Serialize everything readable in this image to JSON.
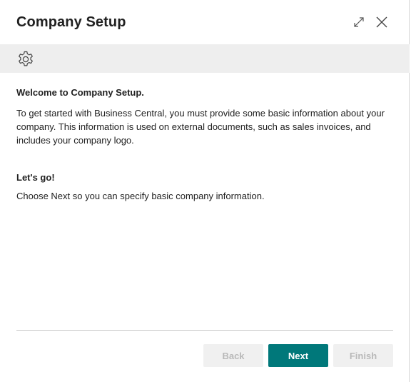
{
  "dialog": {
    "title": "Company Setup",
    "expand_icon": "expand-diagonal-icon",
    "close_icon": "close-x-icon"
  },
  "banner": {
    "icon": "gear-icon"
  },
  "intro": {
    "heading": "Welcome to Company Setup.",
    "body": "To get started with Business Central, you must provide some basic information about your company. This information is used on external documents, such as sales invoices, and includes your company logo."
  },
  "next_step": {
    "heading": "Let's go!",
    "body": "Choose Next so you can specify basic company information."
  },
  "footer": {
    "back_label": "Back",
    "next_label": "Next",
    "finish_label": "Finish",
    "accent_color": "#00787a",
    "disabled_bg": "#f0f0f0",
    "disabled_text": "#b9b9b9"
  }
}
